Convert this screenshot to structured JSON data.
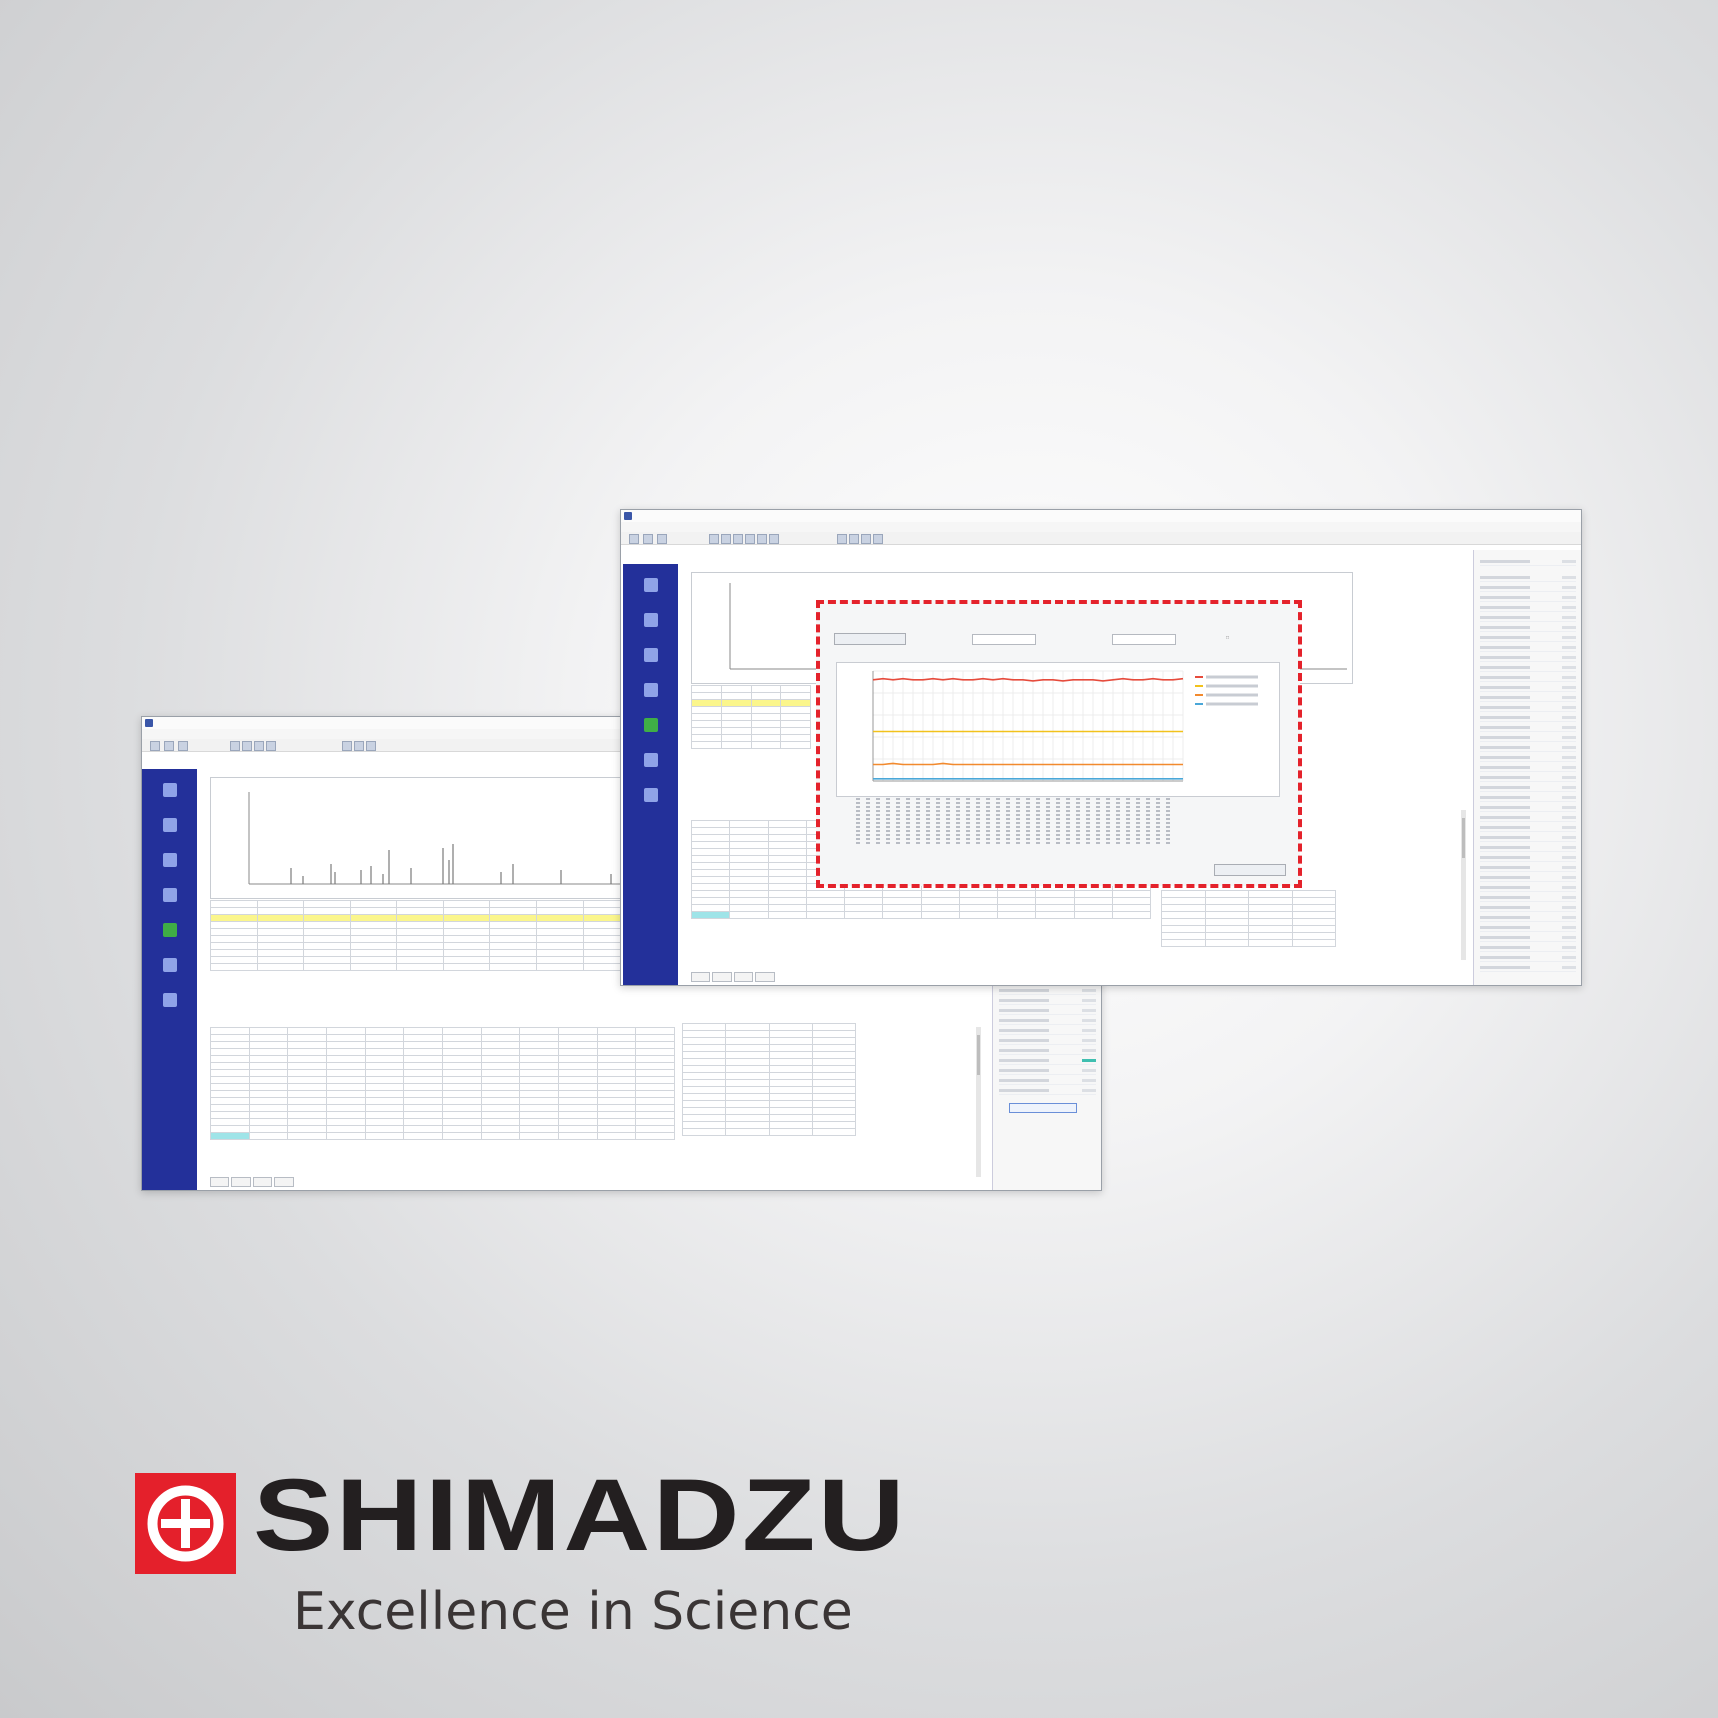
{
  "brand": {
    "company": "SHIMADZU",
    "tagline": "Excellence in Science",
    "mark_color": "#e4202b",
    "mark_icon": "shimadzu-cross-circle-icon"
  },
  "colors": {
    "sidebar": "#23309a",
    "highlight_row": "#fbf68c",
    "selection_dialog_border": "#e4222b",
    "series_1": "#e64b3c",
    "series_2": "#f2c21b",
    "series_3": "#f28a2e",
    "series_4": "#4aa7d8"
  },
  "screens": {
    "back_window": {
      "sidebar_icons": [
        "analysis-icon",
        "element-icon",
        "sample-icon",
        "calibration-icon",
        "report-icon",
        "settings-icon",
        "export-icon"
      ]
    },
    "front_window": {
      "sidebar_icons": [
        "analysis-icon",
        "element-icon",
        "sample-icon",
        "calibration-icon",
        "report-icon",
        "settings-icon",
        "export-icon"
      ]
    }
  },
  "dialog": {
    "chart_data": {
      "type": "line",
      "series": [
        {
          "values": [
            0.92,
            0.93,
            0.92,
            0.93,
            0.92,
            0.92,
            0.93,
            0.92,
            0.93,
            0.92,
            0.92,
            0.93,
            0.92,
            0.93,
            0.92,
            0.92,
            0.91,
            0.92,
            0.92,
            0.91,
            0.92,
            0.92,
            0.92,
            0.91,
            0.92,
            0.93,
            0.92,
            0.92,
            0.93,
            0.92,
            0.92,
            0.93
          ]
        },
        {
          "values": [
            0.45,
            0.45,
            0.45,
            0.45,
            0.45,
            0.45,
            0.45,
            0.45,
            0.45,
            0.45,
            0.45,
            0.45,
            0.45,
            0.45,
            0.45,
            0.45,
            0.45,
            0.45,
            0.45,
            0.45,
            0.45,
            0.45,
            0.45,
            0.45,
            0.45,
            0.45,
            0.45,
            0.45,
            0.45,
            0.45,
            0.45,
            0.45
          ]
        },
        {
          "values": [
            0.15,
            0.15,
            0.16,
            0.15,
            0.15,
            0.15,
            0.15,
            0.16,
            0.15,
            0.15,
            0.15,
            0.15,
            0.15,
            0.15,
            0.15,
            0.15,
            0.15,
            0.15,
            0.15,
            0.15,
            0.15,
            0.15,
            0.15,
            0.15,
            0.15,
            0.15,
            0.15,
            0.15,
            0.15,
            0.15,
            0.15,
            0.15
          ]
        },
        {
          "values": [
            0.02,
            0.02,
            0.02,
            0.02,
            0.02,
            0.02,
            0.02,
            0.02,
            0.02,
            0.02,
            0.02,
            0.02,
            0.02,
            0.02,
            0.02,
            0.02,
            0.02,
            0.02,
            0.02,
            0.02,
            0.02,
            0.02,
            0.02,
            0.02,
            0.02,
            0.02,
            0.02,
            0.02,
            0.02,
            0.02,
            0.02,
            0.02
          ]
        }
      ],
      "ylim": [
        0,
        1
      ],
      "grid": true,
      "legend": "top-right"
    }
  }
}
